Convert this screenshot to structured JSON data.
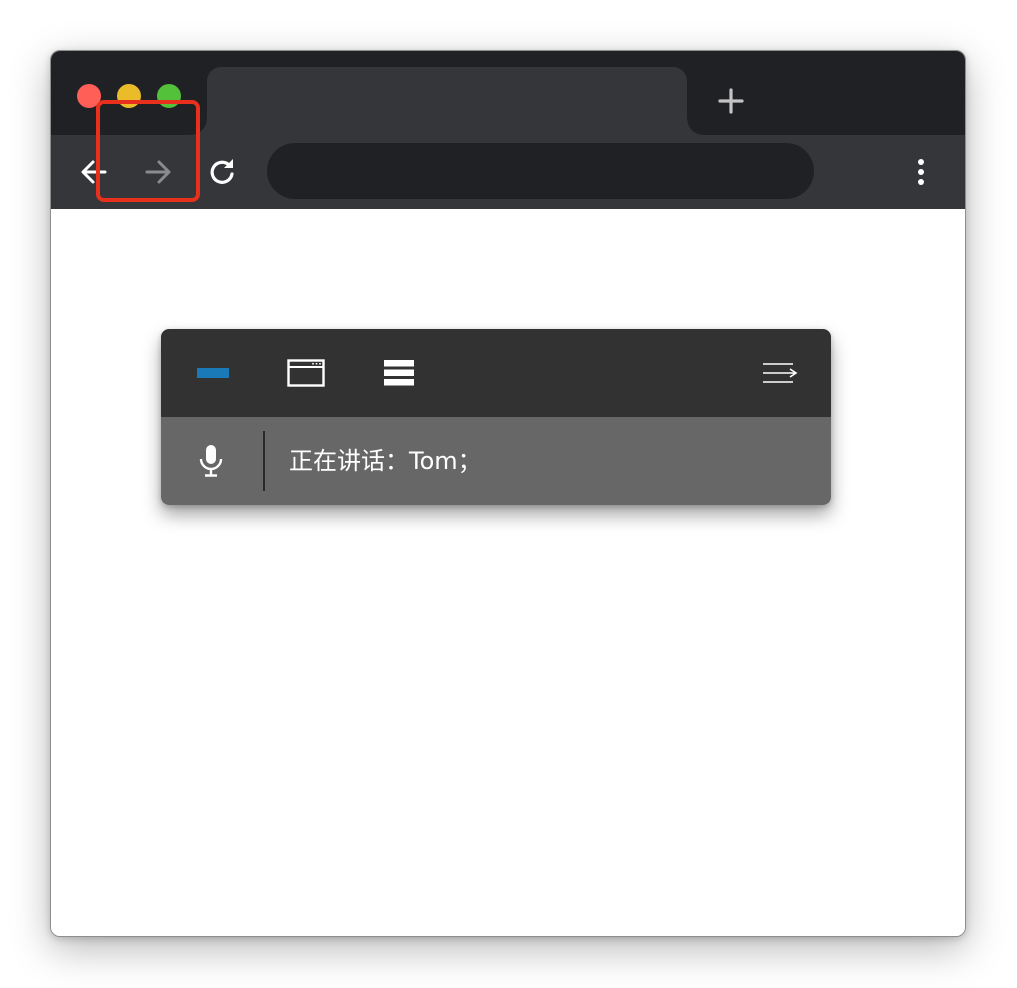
{
  "window": {
    "tab_title": "",
    "address": ""
  },
  "panel": {
    "buttons": [
      {
        "icon": "minimize-icon",
        "active_color": "#1a7ab8"
      },
      {
        "icon": "window-icon"
      },
      {
        "icon": "list-icon"
      },
      {
        "icon": "collapse-menu-icon"
      }
    ],
    "status_icon": "microphone-icon",
    "status_text": "正在讲话：Tom；"
  },
  "colors": {
    "highlight": "#e8301c",
    "accent": "#1a7ab8"
  }
}
